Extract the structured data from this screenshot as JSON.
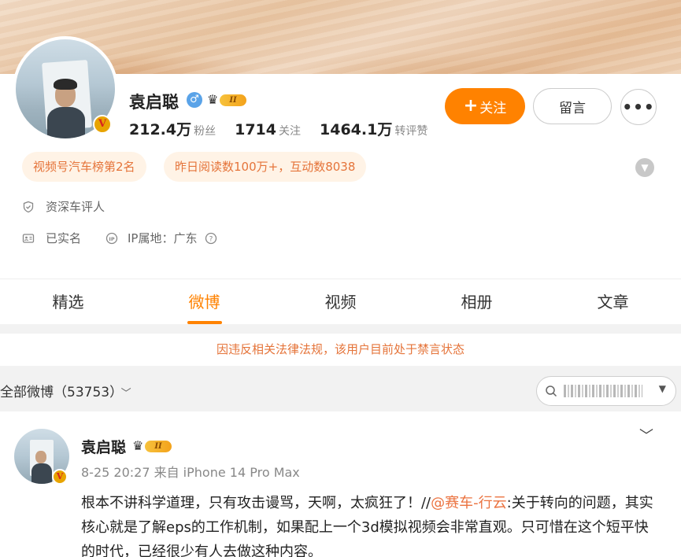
{
  "profile": {
    "name": "袁启聪",
    "gender_icon": "male-icon",
    "vip_level": "II",
    "stats": [
      {
        "value": "212.4万",
        "label": "粉丝"
      },
      {
        "value": "1714",
        "label": "关注"
      },
      {
        "value": "1464.1万",
        "label": "转评赞"
      }
    ],
    "follow_label": "关注",
    "message_label": "留言",
    "more_label": "•••",
    "tags": [
      "视频号汽车榜第2名",
      "昨日阅读数100万+，互动数8038"
    ],
    "verification": "资深车评人",
    "real_name": "已实名",
    "ip_location": "IP属地：广东"
  },
  "tabs": [
    "精选",
    "微博",
    "视频",
    "相册",
    "文章"
  ],
  "active_tab": "微博",
  "ban_notice": "因违反相关法律法规，该用户目前处于禁言状态",
  "feed": {
    "filter_label": "全部微博（53753）",
    "search_placeholder": ""
  },
  "post": {
    "author": "袁启聪",
    "vip_level": "II",
    "meta": "8-25 20:27 来自 iPhone 14 Pro Max",
    "text_before": "根本不讲科学道理，只有攻击谩骂，天啊，太疯狂了！//",
    "mention": "@赛车-行云",
    "text_after": ":关于转向的问题，其实核心就是了解eps的工作机制，如果配上一个3d模拟视频会非常直观。只可惜在这个短平快的时代，已经很少有人去做这种内容。"
  },
  "colors": {
    "accent": "#ff8200",
    "tag_bg": "#fff3e6",
    "tag_text": "#e5743a",
    "mention": "#eb7340"
  }
}
